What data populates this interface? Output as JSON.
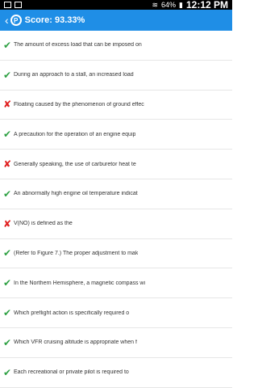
{
  "status": {
    "battery": "64%",
    "time": "12:12 PM"
  },
  "header": {
    "title": "Score: 93.33%"
  },
  "results": [
    {
      "text": "The amount of excess load that can be imposed on",
      "correct": true
    },
    {
      "text": "During an approach to a stall, an increased load",
      "correct": true
    },
    {
      "text": "Floating caused by the phenomenon of ground effec",
      "correct": false
    },
    {
      "text": "A precaution for the operation of an engine equip",
      "correct": true
    },
    {
      "text": "Generally speaking, the use of carburetor heat te",
      "correct": false
    },
    {
      "text": "An abnormally high engine oil temperature indicat",
      "correct": true
    },
    {
      "text": "V(NO) is defined as the",
      "correct": false
    },
    {
      "text": "(Refer to Figure 7.) The proper adjustment to mak",
      "correct": true
    },
    {
      "text": "In the Northern Hemisphere, a magnetic compass wi",
      "correct": true
    },
    {
      "text": "Which preflight action is specifically required o",
      "correct": true
    },
    {
      "text": "Which VFR cruising altitude is appropriate when f",
      "correct": true
    },
    {
      "text": "Each recreational or private pilot is required to",
      "correct": true
    }
  ]
}
